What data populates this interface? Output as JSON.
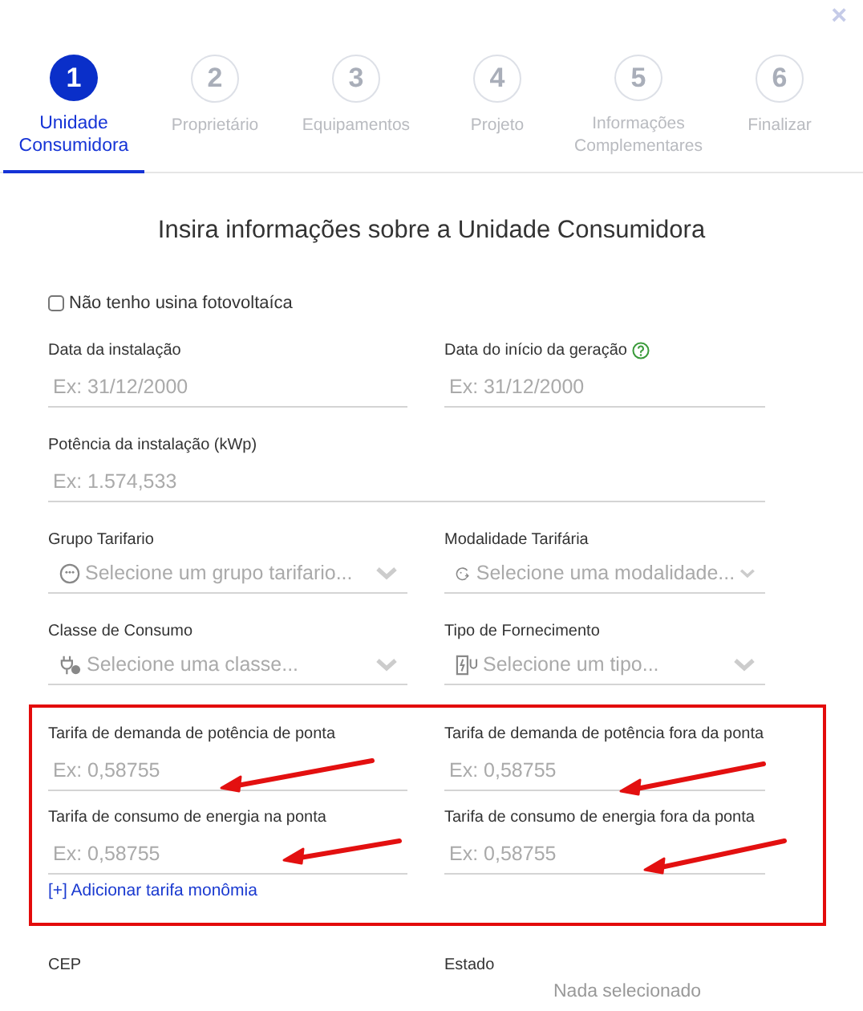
{
  "close": "×",
  "steps": [
    {
      "number": "1",
      "label": "Unidade Consumidora",
      "selected": true
    },
    {
      "number": "2",
      "label": "Proprietário",
      "selected": false
    },
    {
      "number": "3",
      "label": "Equipamentos",
      "selected": false
    },
    {
      "number": "4",
      "label": "Projeto",
      "selected": false
    },
    {
      "number": "5",
      "label": "Informações Complementares",
      "selected": false
    },
    {
      "number": "6",
      "label": "Finalizar",
      "selected": false
    }
  ],
  "title": "Insira informações sobre a Unidade Consumidora",
  "checkbox": {
    "label": "Não tenho usina fotovoltaíca",
    "checked": false
  },
  "fields": [
    {
      "kind": "text",
      "label": "Data da instalação",
      "placeholder": "Ex: 31/12/2000"
    },
    {
      "kind": "text",
      "label": "Data do início da geração",
      "placeholder": "Ex: 31/12/2000",
      "help": true
    },
    {
      "kind": "text",
      "label": "Potência da instalação (kWp)",
      "placeholder": "Ex: 1.574,533",
      "wide": true
    },
    {
      "kind": "select",
      "label": "Grupo Tarifario",
      "placeholder": "Selecione um grupo tarifario..."
    },
    {
      "kind": "select",
      "label": "Modalidade Tarifária",
      "placeholder": "Selecione uma modalidade..."
    },
    {
      "kind": "select",
      "label": "Classe de Consumo",
      "placeholder": "Selecione uma classe..."
    },
    {
      "kind": "select",
      "label": "Tipo de Fornecimento",
      "placeholder": "Selecione um tipo..."
    }
  ],
  "tariffs": [
    {
      "label": "Tarifa de demanda de potência de ponta",
      "placeholder": "Ex: 0,58755"
    },
    {
      "label": "Tarifa de demanda de potência fora da ponta",
      "placeholder": "Ex: 0,58755"
    },
    {
      "label": "Tarifa de consumo de energia na ponta",
      "placeholder": "Ex: 0,58755"
    },
    {
      "label": "Tarifa de consumo de energia fora da ponta",
      "placeholder": "Ex: 0,58755"
    }
  ],
  "add_link": "[+] Adicionar tarifa monômia",
  "bottom": [
    {
      "label": "CEP"
    },
    {
      "label": "Estado",
      "value": "Nada selecionado"
    }
  ]
}
